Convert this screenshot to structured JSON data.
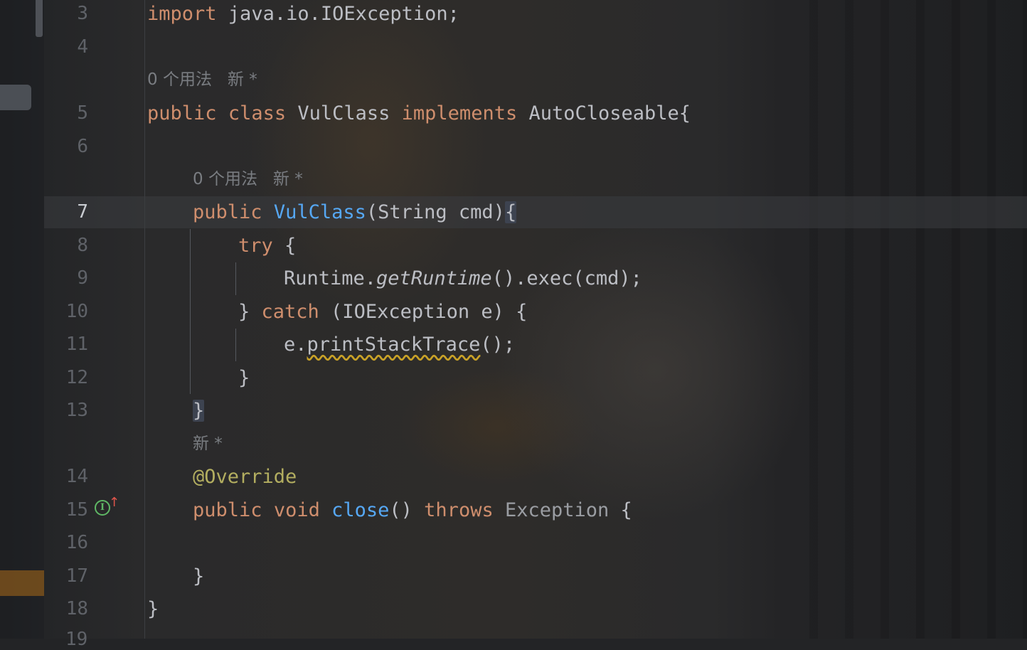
{
  "editor": {
    "lines": [
      {
        "num": "3",
        "tokens": [
          {
            "t": "import",
            "c": "kw"
          },
          {
            "t": " java.io.IOException;"
          }
        ]
      },
      {
        "num": "4",
        "tokens": []
      },
      {
        "num": "5",
        "tokens": [
          {
            "t": "public",
            "c": "kw"
          },
          {
            "t": " "
          },
          {
            "t": "class",
            "c": "kw"
          },
          {
            "t": " VulClass "
          },
          {
            "t": "implements",
            "c": "kw"
          },
          {
            "t": " AutoCloseable{"
          }
        ]
      },
      {
        "num": "6",
        "tokens": []
      },
      {
        "num": "7",
        "tokens": [
          {
            "t": "public",
            "c": "kw"
          },
          {
            "t": " "
          },
          {
            "t": "VulClass",
            "c": "fn"
          },
          {
            "t": "(String cmd)"
          },
          {
            "t": "{",
            "c": "brace-hl"
          }
        ]
      },
      {
        "num": "8",
        "tokens": [
          {
            "t": "try",
            "c": "kw"
          },
          {
            "t": " {"
          }
        ]
      },
      {
        "num": "9",
        "tokens": [
          {
            "t": "Runtime."
          },
          {
            "t": "getRuntime",
            "c": "it"
          },
          {
            "t": "().exec(cmd);"
          }
        ]
      },
      {
        "num": "10",
        "tokens": [
          {
            "t": "} "
          },
          {
            "t": "catch",
            "c": "kw"
          },
          {
            "t": " (IOException e) {"
          }
        ]
      },
      {
        "num": "11",
        "tokens": [
          {
            "t": "e."
          },
          {
            "t": "printStackTrace",
            "c": "warn"
          },
          {
            "t": "();"
          }
        ]
      },
      {
        "num": "12",
        "tokens": [
          {
            "t": "}"
          }
        ]
      },
      {
        "num": "13",
        "tokens": [
          {
            "t": "}",
            "c": "brace-hl"
          }
        ]
      },
      {
        "num": "14",
        "tokens": [
          {
            "t": "@Override",
            "c": "ann"
          }
        ]
      },
      {
        "num": "15",
        "tokens": [
          {
            "t": "public",
            "c": "kw"
          },
          {
            "t": " "
          },
          {
            "t": "void",
            "c": "kw"
          },
          {
            "t": " "
          },
          {
            "t": "close",
            "c": "fn"
          },
          {
            "t": "() "
          },
          {
            "t": "throws",
            "c": "kw"
          },
          {
            "t": " "
          },
          {
            "t": "Exception",
            "c": "gray"
          },
          {
            "t": " {"
          }
        ]
      },
      {
        "num": "16",
        "tokens": []
      },
      {
        "num": "17",
        "tokens": [
          {
            "t": "}"
          }
        ]
      },
      {
        "num": "18",
        "tokens": [
          {
            "t": "}"
          }
        ]
      }
    ],
    "hints": {
      "class_usages": "0 个用法   新 *",
      "constructor_usages": "0 个用法   新 *",
      "override_author": "新 *"
    },
    "active_line": "7",
    "partial_next_line_number": "19",
    "gutter_icons": [
      {
        "line": "15",
        "icon": "implements-method-icon",
        "color": "#5fb865",
        "arrow_color": "#e0554c"
      }
    ],
    "colors": {
      "keyword": "#cf8e6d",
      "function": "#56a8f5",
      "annotation": "#b3ae60",
      "default_text": "#bcbec4",
      "line_number": "#5f6268",
      "warning_underline": "#c9a227"
    }
  }
}
